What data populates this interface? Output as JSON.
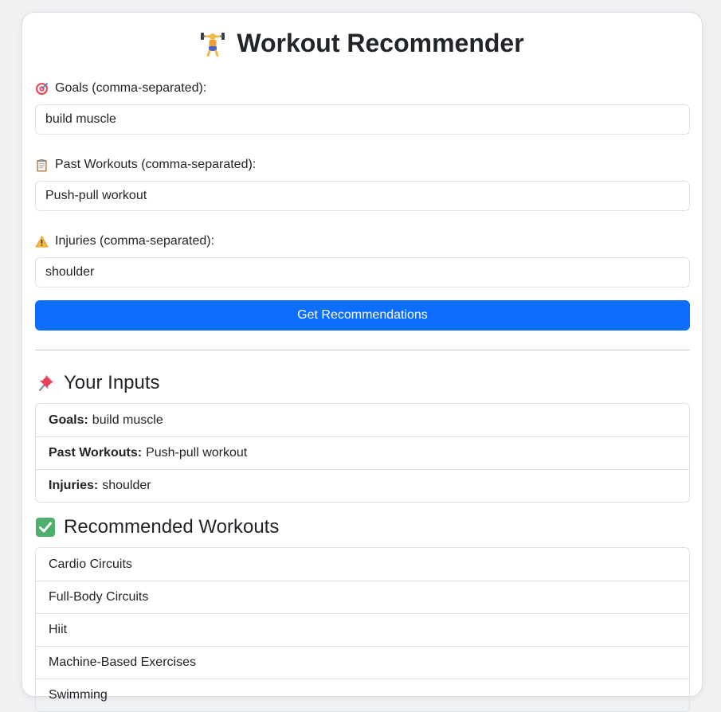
{
  "title": "Workout Recommender",
  "form": {
    "goals_label": "Goals (comma-separated):",
    "goals_value": "build muscle",
    "past_label": "Past Workouts (comma-separated):",
    "past_value": "Push-pull workout",
    "injuries_label": "Injuries (comma-separated):",
    "injuries_value": "shoulder",
    "submit_label": "Get Recommendations"
  },
  "inputs_section": {
    "title": "Your Inputs",
    "rows": [
      {
        "key": "Goals:",
        "value": "build muscle"
      },
      {
        "key": "Past Workouts:",
        "value": "Push-pull workout"
      },
      {
        "key": "Injuries:",
        "value": "shoulder"
      }
    ]
  },
  "recommendations_section": {
    "title": "Recommended Workouts",
    "items": [
      "Cardio Circuits",
      "Full-Body Circuits",
      "Hiit",
      "Machine-Based Exercises",
      "Swimming"
    ]
  },
  "icons": {
    "title": "weightlifter-icon",
    "goals": "target-icon",
    "past": "clipboard-icon",
    "injuries": "warning-icon",
    "inputs": "pushpin-icon",
    "recommendations": "check-mark-icon"
  },
  "colors": {
    "accent": "#0d6efd",
    "background": "#f0f1f3",
    "card": "#ffffff"
  }
}
